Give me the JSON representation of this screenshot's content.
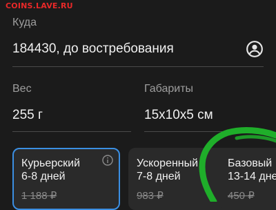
{
  "watermark": "COINS.LAVE.RU",
  "destination": {
    "label": "Куда",
    "value": "184430, до востребования",
    "icon": "account-circle-icon"
  },
  "weight": {
    "label": "Вес",
    "value": "255 г"
  },
  "dimensions": {
    "label": "Габариты",
    "value": "15x10x5 см"
  },
  "delivery_options": [
    {
      "name": "Курьерский",
      "days": "6-8 дней",
      "price": "1 188 ₽",
      "selected": true,
      "icon": "info-icon"
    },
    {
      "name": "Ускоренный",
      "days": "7-8 дней",
      "price": "983 ₽",
      "selected": false
    },
    {
      "name": "Базовый",
      "days": "13-14 дне",
      "price": "450 ₽",
      "selected": false
    }
  ],
  "colors": {
    "background": "#1b1b1b",
    "card": "#2a2a2a",
    "selected_border": "#3b8fe3",
    "watermark": "#ff2a2a",
    "annotation": "#1fae2a"
  }
}
